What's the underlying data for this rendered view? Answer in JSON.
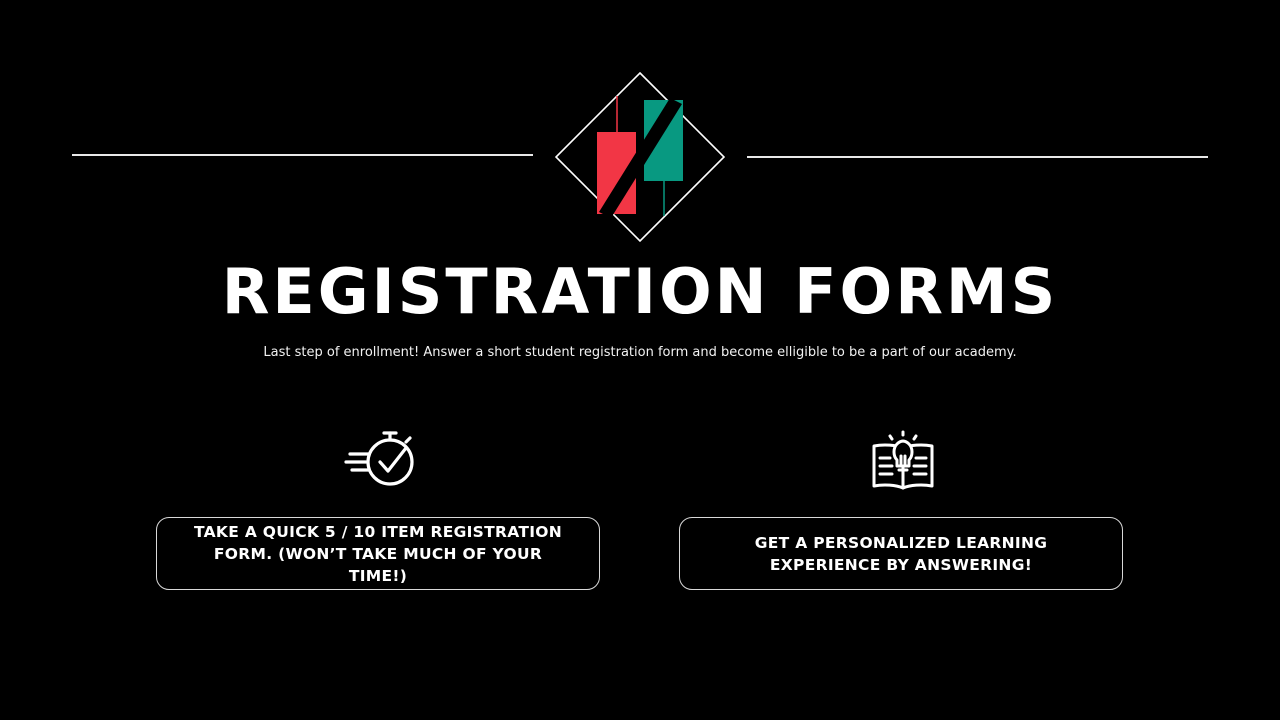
{
  "header": {
    "title": "REGISTRATION FORMS",
    "subtitle": "Last step of enrollment! Answer a short student registration form and become elligible to be a part of our academy."
  },
  "logo": {
    "icon": "candlestick-logo-icon",
    "colors": {
      "outline": "#ffffff",
      "bear_candle": "#f23645",
      "bull_candle": "#089981"
    }
  },
  "features": [
    {
      "icon": "stopwatch-check-icon",
      "text": "TAKE A QUICK 5 / 10 ITEM REGISTRATION\nFORM. (WON’T TAKE MUCH OF YOUR TIME!)"
    },
    {
      "icon": "lightbulb-book-icon",
      "text": "GET A PERSONALIZED LEARNING\nEXPERIENCE BY ANSWERING!"
    }
  ],
  "theme": {
    "background": "#000000",
    "foreground": "#ffffff"
  }
}
